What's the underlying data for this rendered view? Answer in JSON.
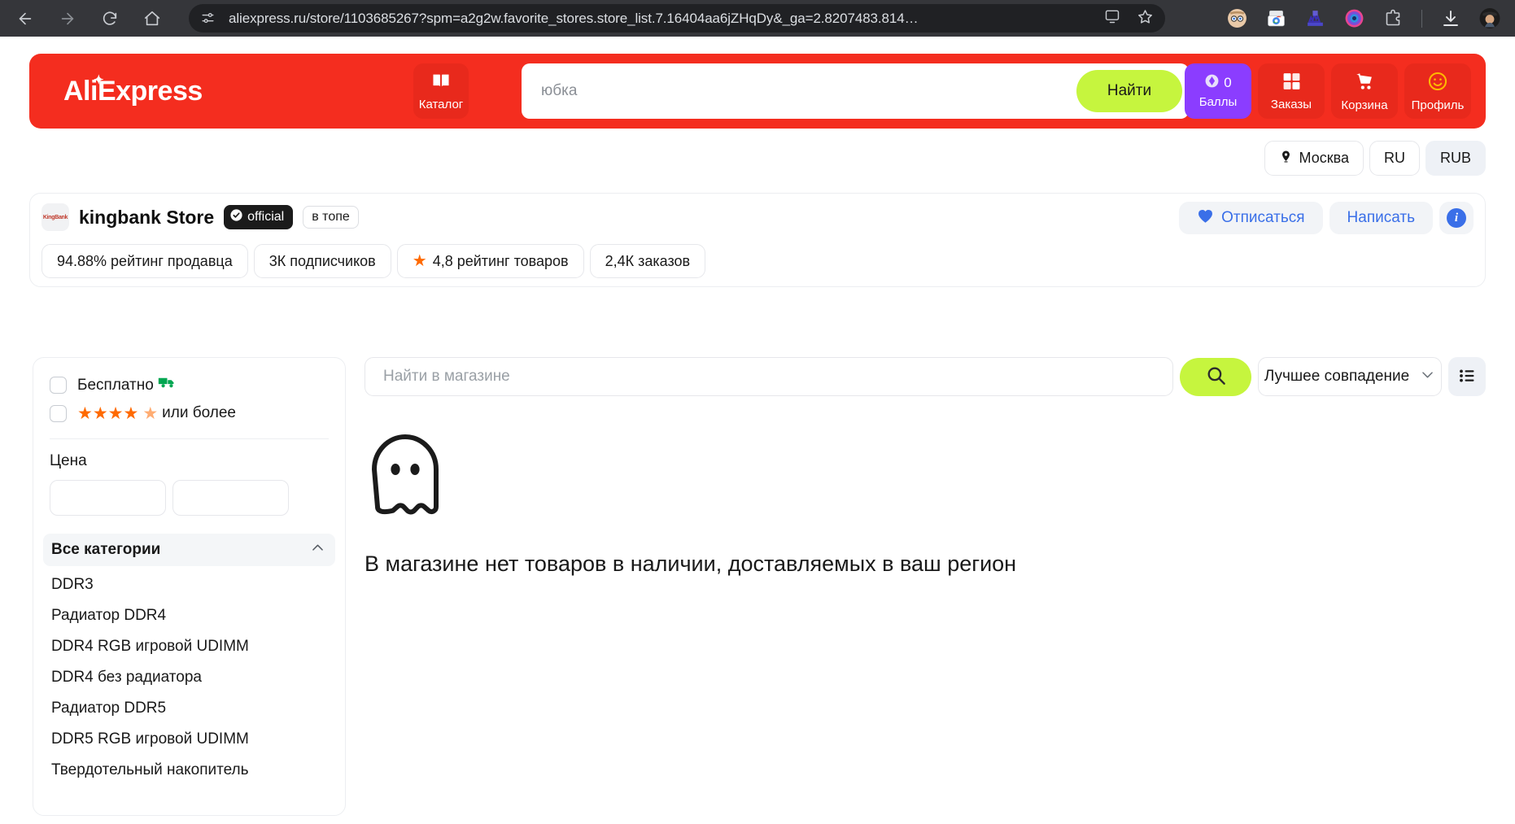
{
  "browser": {
    "url": "aliexpress.ru/store/1103685267?spm=a2g2w.favorite_stores.store_list.7.16404aa6jZHqDy&_ga=2.8207483.814…",
    "nav": {
      "back": "back-arrow",
      "forward": "forward-arrow",
      "reload": "reload",
      "home": "home"
    },
    "icons": [
      "site-settings-icon",
      "install-app-icon",
      "bookmark-star-icon",
      "extension-avatar-icon",
      "extension-chrome-icon",
      "extension-chart-icon",
      "extension-circle-icon",
      "extensions-puzzle-icon",
      "downloads-icon",
      "profile-avatar-icon"
    ]
  },
  "header": {
    "logo": "AliExpress",
    "catalog_label": "Каталог",
    "search_placeholder": "юбка",
    "search_value": "",
    "find_label": "Найти",
    "actions": [
      {
        "name": "points",
        "label": "Баллы",
        "count": "0"
      },
      {
        "name": "orders",
        "label": "Заказы"
      },
      {
        "name": "cart",
        "label": "Корзина"
      },
      {
        "name": "profile",
        "label": "Профиль"
      }
    ]
  },
  "locale_bar": {
    "city": "Москва",
    "language": "RU",
    "currency": "RUB"
  },
  "store": {
    "logo_text": "KingBank",
    "name": "kingbank Store",
    "official_badge": "official",
    "top_badge": "в топе",
    "unsubscribe_label": "Отписаться",
    "message_label": "Написать",
    "info_label": "i",
    "stats": [
      {
        "text": "94.88% рейтинг продавца",
        "has_star": false
      },
      {
        "text": "3К подписчиков",
        "has_star": false
      },
      {
        "text": "4,8 рейтинг товаров",
        "has_star": true
      },
      {
        "text": "2,4К заказов",
        "has_star": false
      }
    ]
  },
  "sidebar": {
    "free_shipping_label": "Бесплатно",
    "rating_label": "или более",
    "rating_stars": "★★★★",
    "rating_half": "★",
    "price_title": "Цена",
    "price_min": "",
    "price_max": "",
    "price_min_placeholder": "",
    "price_max_placeholder": "",
    "categories_title": "Все категории",
    "categories": [
      "DDR3",
      "Радиатор DDR4",
      "DDR4 RGB игровой UDIMM",
      "DDR4 без радиатора",
      "Радиатор DDR5",
      "DDR5 RGB игровой UDIMM",
      "Твердотельный накопитель"
    ]
  },
  "main": {
    "store_search_placeholder": "Найти в магазине",
    "store_search_value": "",
    "sort_label": "Лучшее совпадение",
    "empty_message": "В магазине нет товаров в наличии, доставляемых в ваш регион"
  },
  "colors": {
    "brand_red": "#f42d1f",
    "tile_red": "#e8291c",
    "accent_green": "#c6f53e",
    "points_purple": "#8b3dff",
    "link_blue": "#3a6fe8",
    "star_orange": "#ff6a00",
    "truck_green": "#00a651"
  }
}
